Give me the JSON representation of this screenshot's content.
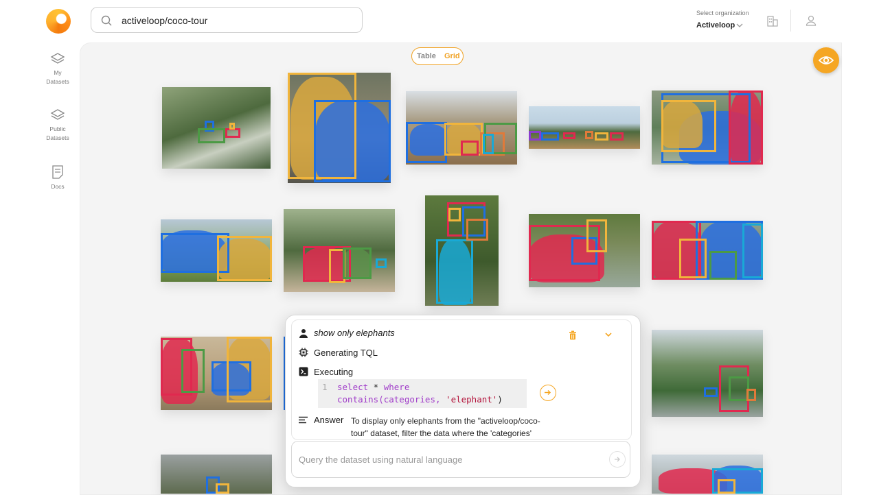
{
  "header": {
    "search_value": "activeloop/coco-tour",
    "org_label": "Select organization",
    "org_value": "Activeloop"
  },
  "sidebar": {
    "items": [
      {
        "line1": "My",
        "line2": "Datasets",
        "icon": "layers-icon"
      },
      {
        "line1": "Public",
        "line2": "Datasets",
        "icon": "layers-icon"
      },
      {
        "line1": "Docs",
        "line2": "",
        "icon": "document-icon"
      }
    ]
  },
  "view_toggle": {
    "table_label": "Table",
    "grid_label": "Grid",
    "active": "Grid"
  },
  "chat": {
    "user_query": "show only elephants",
    "step_generating": "Generating TQL",
    "step_executing": "Executing",
    "code_line_number": "1",
    "code_line1_kw1": "select",
    "code_line1_op": " * ",
    "code_line1_kw2": "where",
    "code_line2_fn": "contains(categories, ",
    "code_line2_str": "'elephant'",
    "code_line2_end": ")",
    "answer_label": "Answer",
    "answer_text": "To display only elephants from the \"activeloop/coco-tour\" dataset, filter the data where the 'categories'",
    "input_placeholder": "Query the dataset using natural language"
  },
  "colors": {
    "accent": "#f5a623",
    "blue": "#1f6fe0",
    "yellow": "#f1b53c",
    "red": "#e0294f",
    "green": "#4c9a45",
    "cyan": "#19a9d6"
  }
}
